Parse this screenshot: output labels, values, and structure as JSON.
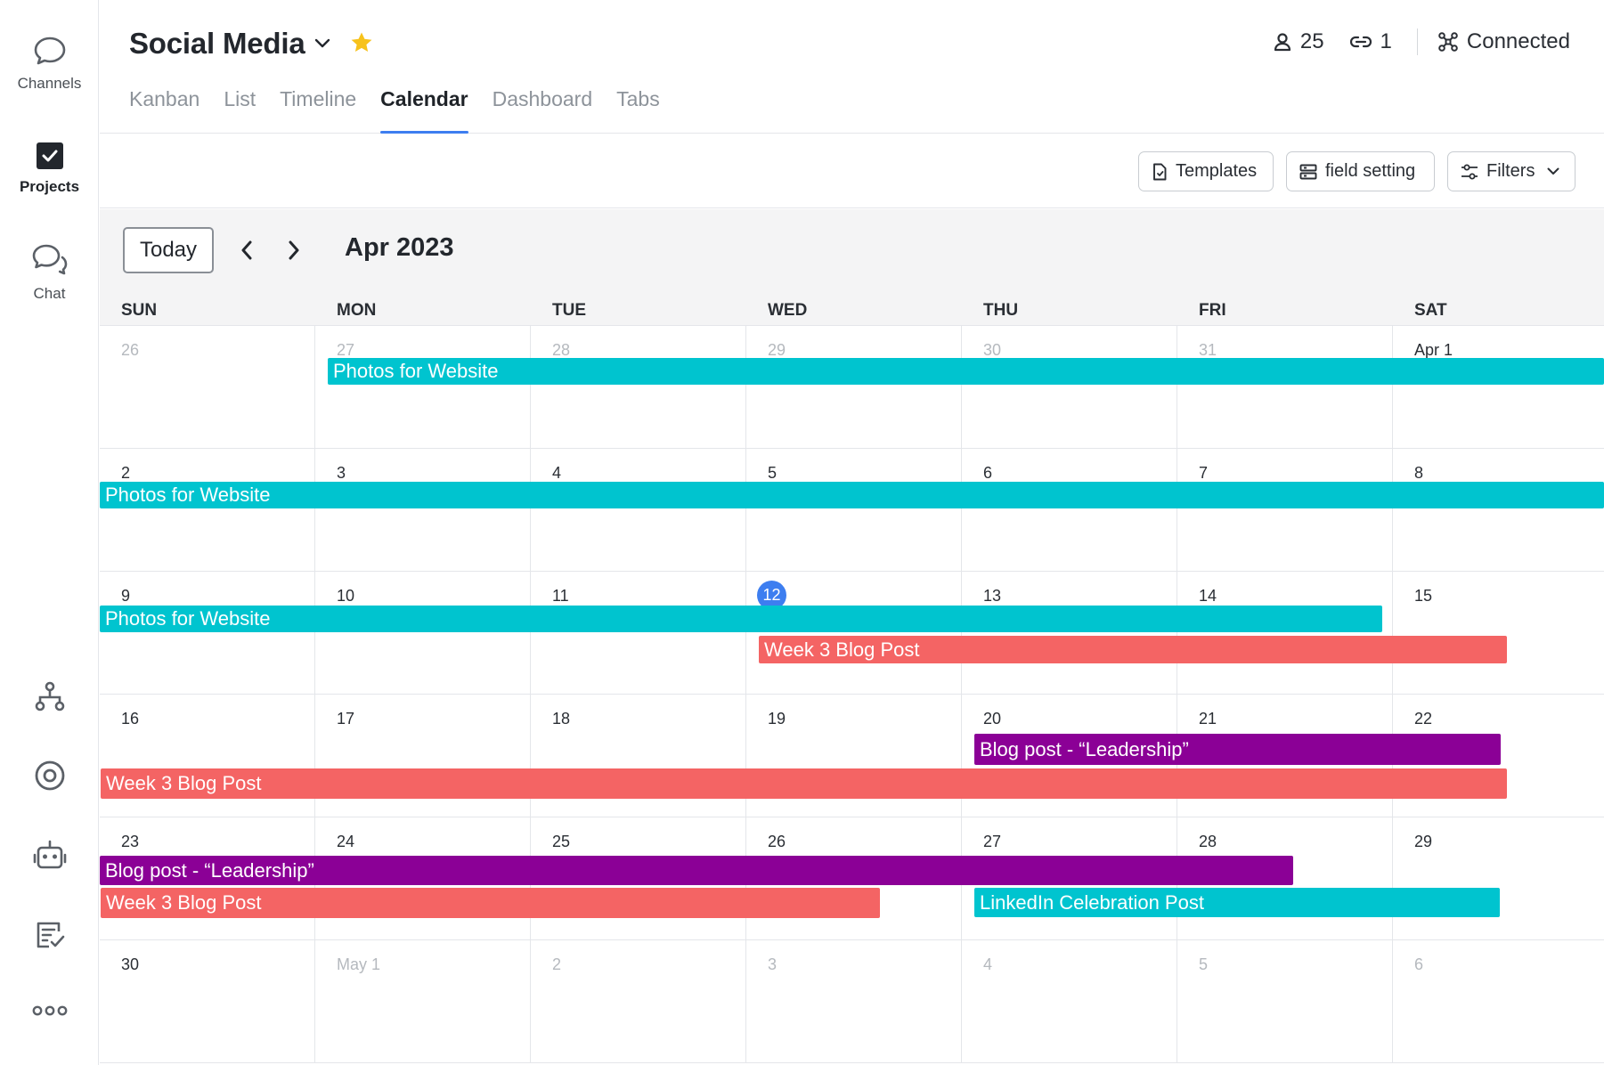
{
  "rail": {
    "top_items": [
      {
        "label": "Channels",
        "icon": "chat-bubble-icon"
      },
      {
        "label": "Projects",
        "icon": "checkbox-icon",
        "active": true
      },
      {
        "label": "Chat",
        "icon": "chat-bubbles-icon"
      }
    ],
    "bottom_icons": [
      "hierarchy-icon",
      "target-icon",
      "robot-icon",
      "form-check-icon",
      "more-icon"
    ]
  },
  "header": {
    "title": "Social Media",
    "members_count": "25",
    "links_count": "1",
    "connection_status": "Connected",
    "tabs": [
      "Kanban",
      "List",
      "Timeline",
      "Calendar",
      "Dashboard",
      "Tabs"
    ],
    "active_tab": "Calendar"
  },
  "toolbar": {
    "templates_label": "Templates",
    "field_setting_label": "field setting",
    "filters_label": "Filters"
  },
  "calendar": {
    "today_label": "Today",
    "month_label": "Apr 2023",
    "weekdays": [
      "SUN",
      "MON",
      "TUE",
      "WED",
      "THU",
      "FRI",
      "SAT"
    ],
    "weeks": [
      [
        {
          "d": "26",
          "m": true
        },
        {
          "d": "27",
          "m": true
        },
        {
          "d": "28",
          "m": true
        },
        {
          "d": "29",
          "m": true
        },
        {
          "d": "30",
          "m": true
        },
        {
          "d": "31",
          "m": true
        },
        {
          "d": "Apr 1"
        }
      ],
      [
        {
          "d": "2"
        },
        {
          "d": "3"
        },
        {
          "d": "4"
        },
        {
          "d": "5"
        },
        {
          "d": "6"
        },
        {
          "d": "7"
        },
        {
          "d": "8"
        }
      ],
      [
        {
          "d": "9"
        },
        {
          "d": "10"
        },
        {
          "d": "11"
        },
        {
          "d": "12",
          "today": true
        },
        {
          "d": "13"
        },
        {
          "d": "14"
        },
        {
          "d": "15"
        }
      ],
      [
        {
          "d": "16"
        },
        {
          "d": "17"
        },
        {
          "d": "18"
        },
        {
          "d": "19"
        },
        {
          "d": "20"
        },
        {
          "d": "21"
        },
        {
          "d": "22"
        }
      ],
      [
        {
          "d": "23"
        },
        {
          "d": "24"
        },
        {
          "d": "25"
        },
        {
          "d": "26"
        },
        {
          "d": "27"
        },
        {
          "d": "28"
        },
        {
          "d": "29"
        }
      ],
      [
        {
          "d": "30"
        },
        {
          "d": "May 1",
          "m": true
        },
        {
          "d": "2",
          "m": true
        },
        {
          "d": "3",
          "m": true
        },
        {
          "d": "4",
          "m": true
        },
        {
          "d": "5",
          "m": true
        },
        {
          "d": "6",
          "m": true
        }
      ]
    ],
    "colors": {
      "teal": "#00c4cf",
      "coral": "#f46464",
      "purple": "#8b0096",
      "accent": "#3d7ef0"
    },
    "events": [
      {
        "title": "Photos for Website",
        "color": "teal",
        "start": "2023-03-27",
        "end": "2023-04-14"
      },
      {
        "title": "Week 3 Blog Post",
        "color": "coral",
        "start": "2023-04-12",
        "end": "2023-04-26"
      },
      {
        "title": "Blog post - “Leadership”",
        "color": "purple",
        "start": "2023-04-20",
        "end": "2023-04-28"
      },
      {
        "title": "LinkedIn Celebration Post",
        "color": "teal",
        "start": "2023-04-27",
        "end": "2023-04-29"
      }
    ]
  }
}
